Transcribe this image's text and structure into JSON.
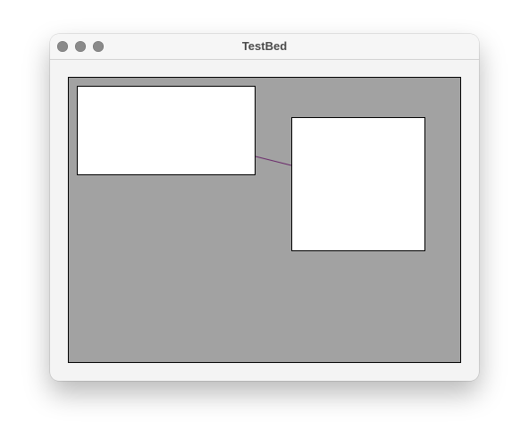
{
  "window": {
    "title": "TestBed"
  },
  "colors": {
    "canvas_background": "#a2a2a2",
    "box_fill": "#ffffff",
    "box_stroke": "#000000",
    "connector_stroke": "#6b2a6b",
    "traffic_light": "#8a8a8a"
  },
  "icons": {
    "close": "close-dot-icon",
    "minimize": "minimize-dot-icon",
    "zoom": "zoom-dot-icon"
  }
}
